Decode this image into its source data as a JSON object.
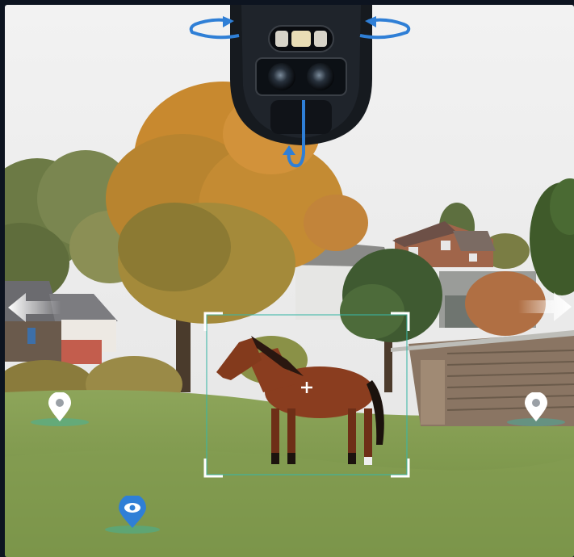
{
  "scene": {
    "subject": "horse-in-pasture",
    "colors": {
      "sky": "#eeeeee",
      "grass": "#7f9a4a",
      "horse": "#8a3d1f",
      "accent_blue": "#2f7fd6",
      "pin_white": "#ffffff",
      "focus_frame": "#ffffff",
      "focus_inner": "#39b6a6"
    }
  },
  "camera": {
    "icon": "ptz-dual-lens-camera",
    "rotate_left_icon": "rotate-arrow-left-icon",
    "rotate_right_icon": "rotate-arrow-right-icon",
    "tilt_icon": "tilt-arrow-down-icon"
  },
  "controls": {
    "pan_left_icon": "arrow-left-icon",
    "pan_right_icon": "arrow-right-icon",
    "focus_icon": "crosshair-plus-icon"
  },
  "markers": {
    "preset_pin_icon": "location-pin-icon",
    "active_pin_icon": "eye-pin-icon"
  }
}
